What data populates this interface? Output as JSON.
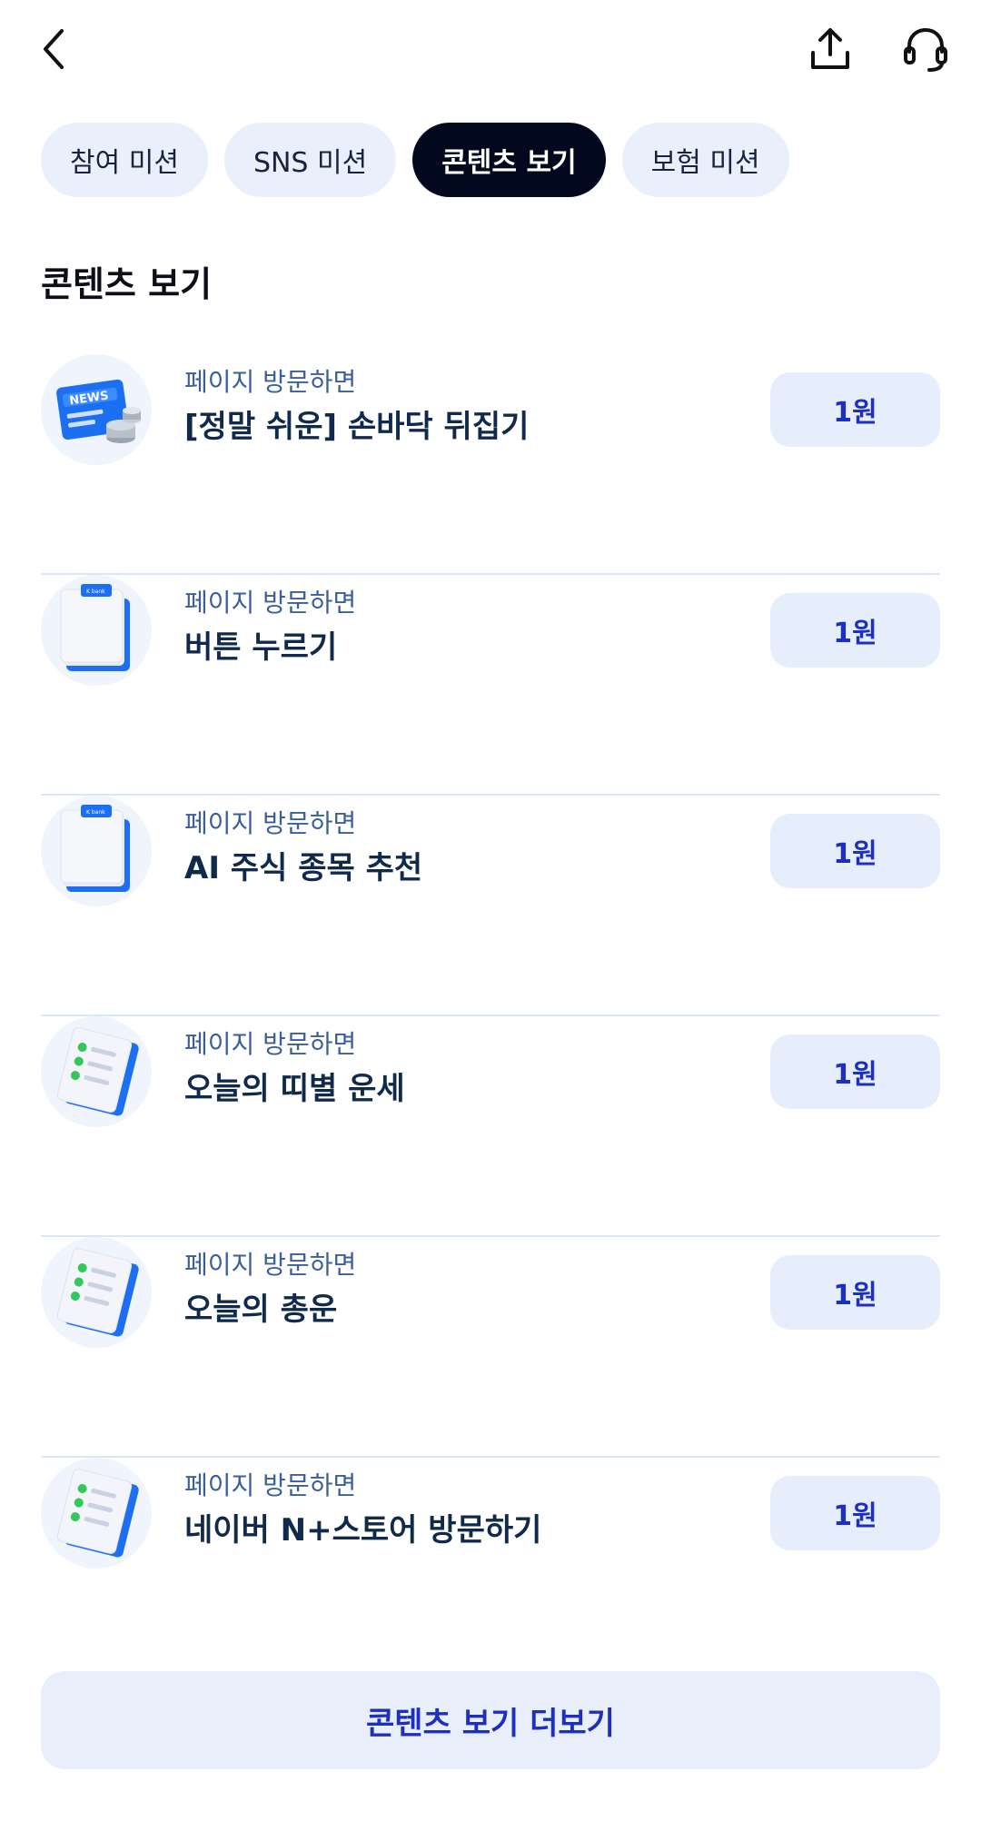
{
  "header": {
    "back_icon": "chevron-left-icon",
    "share_icon": "share-upload-icon",
    "support_icon": "headset-icon"
  },
  "tabs": [
    {
      "label": "참여 미션",
      "active": false
    },
    {
      "label": "SNS 미션",
      "active": false
    },
    {
      "label": "콘텐츠 보기",
      "active": true
    },
    {
      "label": "보험 미션",
      "active": false
    }
  ],
  "section": {
    "title": "콘텐츠 보기"
  },
  "items": [
    {
      "icon": "news-icon",
      "subtitle": "페이지 방문하면",
      "title": "[정말 쉬운] 손바닥 뒤집기",
      "reward": "1원"
    },
    {
      "icon": "clipboard-icon",
      "subtitle": "페이지 방문하면",
      "title": "버튼 누르기",
      "reward": "1원"
    },
    {
      "icon": "clipboard-icon",
      "subtitle": "페이지 방문하면",
      "title": "AI 주식 종목 추천",
      "reward": "1원"
    },
    {
      "icon": "checklist-icon",
      "subtitle": "페이지 방문하면",
      "title": "오늘의 띠별 운세",
      "reward": "1원"
    },
    {
      "icon": "checklist-icon",
      "subtitle": "페이지 방문하면",
      "title": "오늘의 총운",
      "reward": "1원"
    },
    {
      "icon": "checklist-icon",
      "subtitle": "페이지 방문하면",
      "title": "네이버 N+스토어 방문하기",
      "reward": "1원"
    }
  ],
  "more_button": {
    "label": "콘텐츠 보기 더보기"
  },
  "colors": {
    "accent": "#1d2fbf",
    "active_tab": "#02091e",
    "chip_bg": "#eaf0fb"
  }
}
